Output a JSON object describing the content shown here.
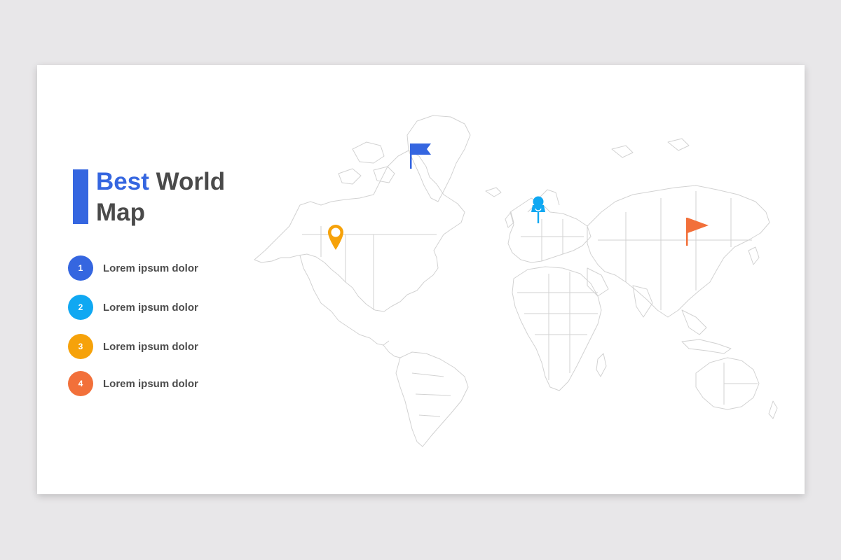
{
  "slide": {
    "title_accent": "Best",
    "title_rest": "World",
    "title_line2": "Map"
  },
  "legend": [
    {
      "num": "1",
      "label": "Lorem ipsum dolor",
      "color": "#3566e0"
    },
    {
      "num": "2",
      "label": "Lorem ipsum dolor",
      "color": "#10a8f2"
    },
    {
      "num": "3",
      "label": "Lorem ipsum dolor",
      "color": "#f6a20a"
    },
    {
      "num": "4",
      "label": "Lorem ipsum dolor",
      "color": "#f2703a"
    }
  ],
  "markers": [
    {
      "icon": "flag-icon",
      "color": "#3566e0",
      "location": "Greenland"
    },
    {
      "icon": "location-pin-icon",
      "color": "#f6a20a",
      "location": "Canada"
    },
    {
      "icon": "push-pin-icon",
      "color": "#10a8f2",
      "location": "Scandinavia"
    },
    {
      "icon": "flag-icon",
      "color": "#f2703a",
      "location": "Siberia"
    }
  ],
  "colors": {
    "accent": "#3566e0",
    "text": "#4a4a4a",
    "map_stroke": "#cfcfcf",
    "background": "#e8e7e9"
  }
}
